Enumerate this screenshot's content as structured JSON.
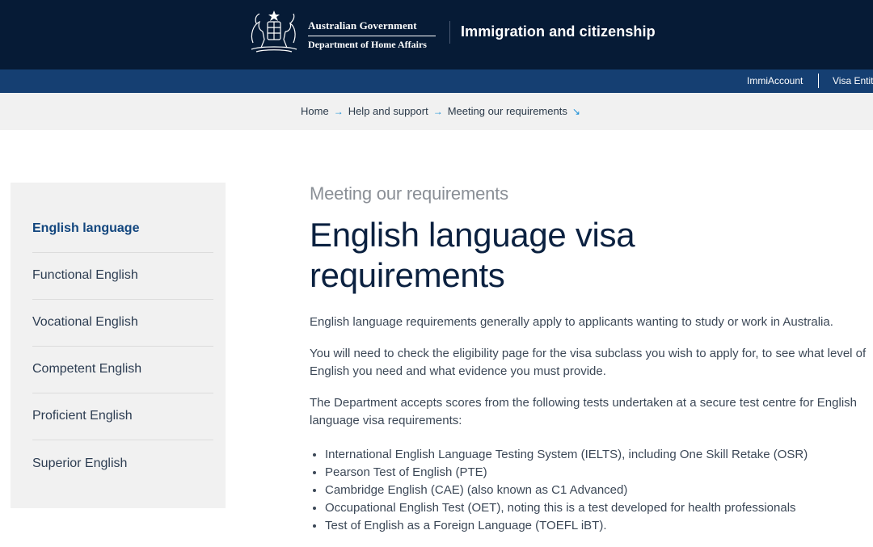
{
  "header": {
    "gov_line1": "Australian Government",
    "gov_line2": "Department of Home Affairs",
    "site_title": "Immigration and citizenship"
  },
  "nav": {
    "links": [
      "ImmiAccount",
      "Visa Entit"
    ]
  },
  "breadcrumb": {
    "items": [
      "Home",
      "Help and support",
      "Meeting our requirements"
    ]
  },
  "sidebar": {
    "items": [
      {
        "label": "English language",
        "active": true
      },
      {
        "label": "Functional English"
      },
      {
        "label": "Vocational English"
      },
      {
        "label": "Competent English"
      },
      {
        "label": "Proficient English"
      },
      {
        "label": "Superior English"
      }
    ]
  },
  "main": {
    "kicker": "Meeting our requirements",
    "title_line1": "English language visa",
    "title_line2": "requirements",
    "para1": "English language requirements generally apply to applicants wanting to study or work in Australia.",
    "para2": "You will need to check the eligibility page for the visa subclass you wish to apply for, to see what level of English you need and what evidence you must provide.",
    "para3": "The Department accepts scores from the following tests undertaken at a secure test centre for English language visa requirements:",
    "tests": [
      "International English Language Testing System (IELTS), including One Skill Retake (OSR)",
      "Pearson Test of English (PTE)",
      "Cambridge English (CAE) (also known as C1 Advanced)",
      "Occupational English Test (OET), noting this is a test developed for health professionals",
      "Test of English as a Foreign Language (TOEFL iBT)."
    ]
  },
  "colors": {
    "header_bg": "#061b36",
    "nav_bg": "#153f72",
    "accent": "#1b8fd6",
    "active_link": "#12467e"
  }
}
